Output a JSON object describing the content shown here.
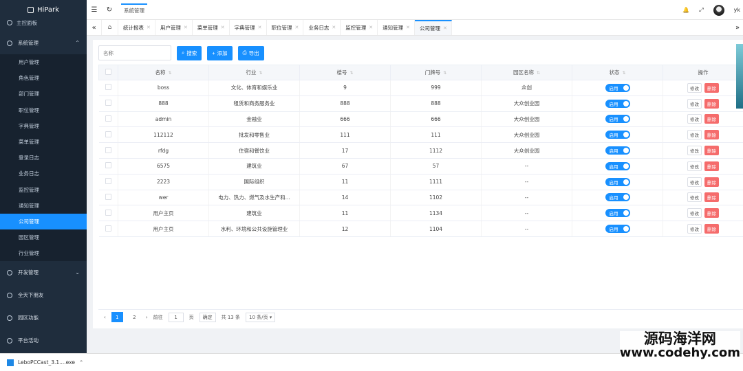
{
  "app": {
    "logo": "HiPark"
  },
  "sidebar": {
    "top_item": "主控面板",
    "groups": [
      {
        "label": "系统管理",
        "icon": "gear-icon",
        "expanded": true
      },
      {
        "label": "开发管理",
        "icon": "dev-icon",
        "expanded": false
      },
      {
        "label": "全天下朋友",
        "icon": "friends-icon",
        "expanded": false
      },
      {
        "label": "园区功能",
        "icon": "park-icon",
        "expanded": false
      },
      {
        "label": "平台活动",
        "icon": "activity-icon",
        "expanded": false
      }
    ],
    "sub_items": [
      {
        "label": "用户管理"
      },
      {
        "label": "角色管理"
      },
      {
        "label": "部门管理"
      },
      {
        "label": "职位管理"
      },
      {
        "label": "字典管理"
      },
      {
        "label": "菜单管理"
      },
      {
        "label": "登录日志"
      },
      {
        "label": "业务日志"
      },
      {
        "label": "监控管理"
      },
      {
        "label": "通知管理"
      },
      {
        "label": "公司管理",
        "active": true
      },
      {
        "label": "园区管理"
      },
      {
        "label": "行业管理"
      }
    ]
  },
  "header": {
    "breadcrumb": "系统管理",
    "username": "yk"
  },
  "tabs": [
    {
      "label": "统计报表"
    },
    {
      "label": "用户管理"
    },
    {
      "label": "菜单管理"
    },
    {
      "label": "字典管理"
    },
    {
      "label": "职位管理"
    },
    {
      "label": "业务日志"
    },
    {
      "label": "监控管理"
    },
    {
      "label": "通知管理"
    },
    {
      "label": "公司管理",
      "active": true
    }
  ],
  "toolbar": {
    "search_placeholder": "名称",
    "search_label": "搜索",
    "add_label": "添加",
    "export_label": "导出"
  },
  "table": {
    "headers": [
      "名称",
      "行业",
      "楼号",
      "门牌号",
      "园区名称",
      "状态",
      "操作"
    ],
    "rows": [
      {
        "name": "boss",
        "industry": "文化、体育和娱乐业",
        "building": "9",
        "door": "999",
        "park": "众创",
        "status": "启用"
      },
      {
        "name": "888",
        "industry": "租赁和商务服务业",
        "building": "888",
        "door": "888",
        "park": "大众创业园",
        "status": "启用"
      },
      {
        "name": "admin",
        "industry": "金融业",
        "building": "666",
        "door": "666",
        "park": "大众创业园",
        "status": "启用"
      },
      {
        "name": "112112",
        "industry": "批发和零售业",
        "building": "111",
        "door": "111",
        "park": "大众创业园",
        "status": "启用"
      },
      {
        "name": "rfdg",
        "industry": "住宿和餐饮业",
        "building": "17",
        "door": "1112",
        "park": "大众创业园",
        "status": "启用"
      },
      {
        "name": "6575",
        "industry": "建筑业",
        "building": "67",
        "door": "57",
        "park": "--",
        "status": "启用"
      },
      {
        "name": "2223",
        "industry": "国际组织",
        "building": "11",
        "door": "1111",
        "park": "--",
        "status": "启用"
      },
      {
        "name": "wer",
        "industry": "电力、热力、燃气及水生产和...",
        "building": "14",
        "door": "1102",
        "park": "--",
        "status": "启用"
      },
      {
        "name": "用户主页",
        "industry": "建筑业",
        "building": "11",
        "door": "1134",
        "park": "--",
        "status": "启用"
      },
      {
        "name": "用户主页",
        "industry": "水利、环境和公共设施管理业",
        "building": "12",
        "door": "1104",
        "park": "--",
        "status": "启用"
      }
    ],
    "edit_label": "修改",
    "delete_label": "删除"
  },
  "pagination": {
    "pages": [
      "1",
      "2"
    ],
    "current": "1",
    "goto_label": "前往",
    "goto_value": "1",
    "page_unit": "页",
    "confirm_label": "确定",
    "total": "共 13 条",
    "page_size": "10 条/页"
  },
  "taskbar": {
    "download": "LeboPCCast_3.1....exe"
  },
  "watermark": {
    "line1": "源码海洋网",
    "line2": "www.codehy.com"
  }
}
